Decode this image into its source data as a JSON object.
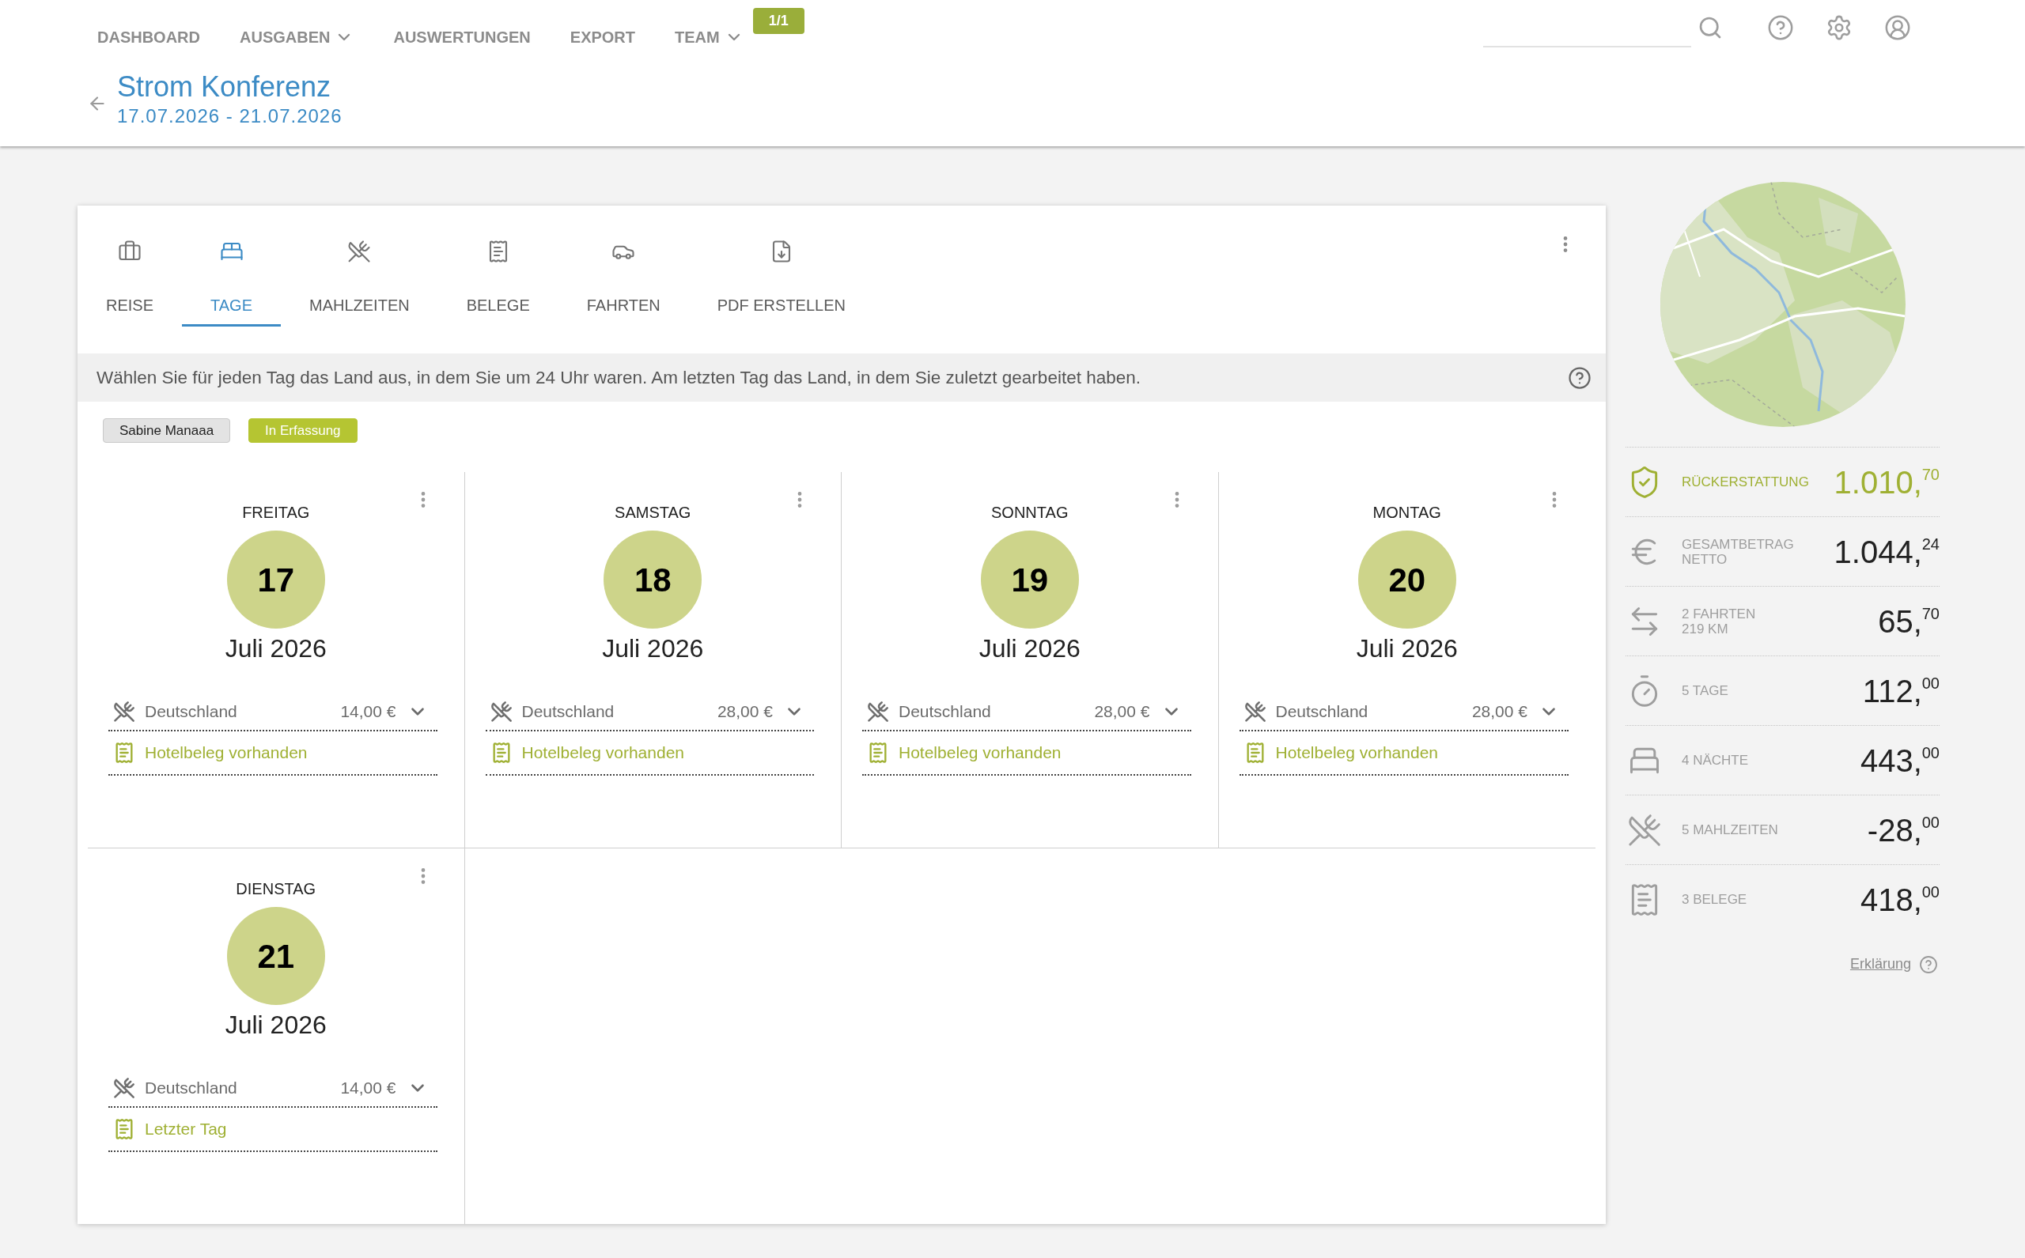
{
  "nav": {
    "items": [
      {
        "label": "DASHBOARD",
        "dropdown": false
      },
      {
        "label": "AUSGABEN",
        "dropdown": true
      },
      {
        "label": "AUSWERTUNGEN",
        "dropdown": false
      },
      {
        "label": "EXPORT",
        "dropdown": false
      },
      {
        "label": "TEAM",
        "dropdown": true
      }
    ],
    "badge": "1/1"
  },
  "trip": {
    "title": "Strom Konferenz",
    "dates": "17.07.2026 - 21.07.2026"
  },
  "tabs": [
    {
      "label": "REISE",
      "selected": false
    },
    {
      "label": "TAGE",
      "selected": true
    },
    {
      "label": "MAHLZEITEN",
      "selected": false
    },
    {
      "label": "BELEGE",
      "selected": false
    },
    {
      "label": "FAHRTEN",
      "selected": false
    },
    {
      "label": "PDF ERSTELLEN",
      "selected": false
    }
  ],
  "info": {
    "text": "Wählen Sie für jeden Tag das Land aus, in dem Sie um 24 Uhr waren. Am letzten Tag das Land, in dem Sie zuletzt gearbeitet haben."
  },
  "tags": [
    {
      "label": "Sabine Manaaa",
      "kind": "person"
    },
    {
      "label": "In Erfassung",
      "kind": "status"
    }
  ],
  "days": [
    {
      "weekday": "FREITAG",
      "day": "17",
      "month": "Juli 2026",
      "country": "Deutschland",
      "amount": "14,00 €",
      "note": "Hotelbeleg vorhanden"
    },
    {
      "weekday": "SAMSTAG",
      "day": "18",
      "month": "Juli 2026",
      "country": "Deutschland",
      "amount": "28,00 €",
      "note": "Hotelbeleg vorhanden"
    },
    {
      "weekday": "SONNTAG",
      "day": "19",
      "month": "Juli 2026",
      "country": "Deutschland",
      "amount": "28,00 €",
      "note": "Hotelbeleg vorhanden"
    },
    {
      "weekday": "MONTAG",
      "day": "20",
      "month": "Juli 2026",
      "country": "Deutschland",
      "amount": "28,00 €",
      "note": "Hotelbeleg vorhanden"
    },
    {
      "weekday": "DIENSTAG",
      "day": "21",
      "month": "Juli 2026",
      "country": "Deutschland",
      "amount": "14,00 €",
      "note": "Letzter Tag"
    }
  ],
  "summary": {
    "rows": [
      {
        "label": [
          "RÜCKERSTATTUNG"
        ],
        "value": "1.010,$^{70}$",
        "highlight": true
      },
      {
        "label": [
          "GESAMTBETRAG",
          "NETTO"
        ],
        "value": "1.044,$^{24}$",
        "highlight": false
      },
      {
        "label": [
          "2 FAHRTEN",
          "219 KM"
        ],
        "value": "65,$^{70}$",
        "highlight": false
      },
      {
        "label": [
          "5 TAGE"
        ],
        "value": "112,$^{00}$",
        "highlight": false
      },
      {
        "label": [
          "4 NÄCHTE"
        ],
        "value": "443,$^{00}$",
        "highlight": false
      },
      {
        "label": [
          "5 MAHLZEITEN"
        ],
        "value": "-28,$^{00}$",
        "highlight": false
      },
      {
        "label": [
          "3 BELEGE"
        ],
        "value": "418,$^{00}$",
        "highlight": false
      }
    ],
    "link": "Erklärung"
  }
}
